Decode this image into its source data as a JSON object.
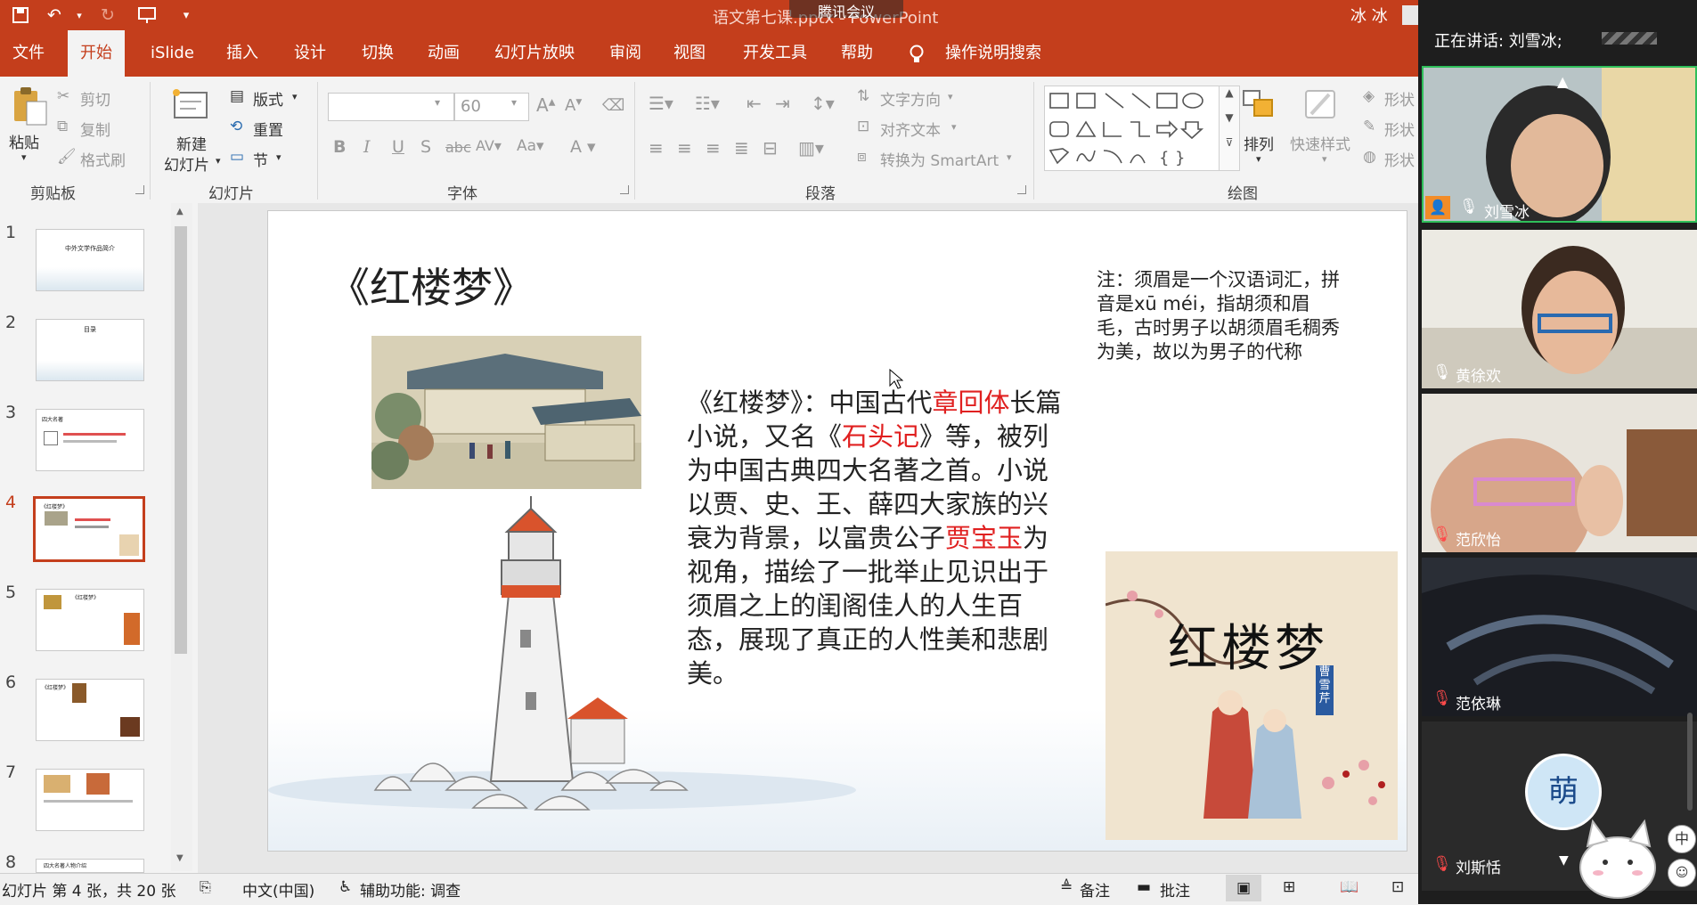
{
  "app": {
    "window_title": "语文第七课.pptx - PowerPoint",
    "meeting_pill": "腾讯会议",
    "user_name": "冰 冰"
  },
  "tabs": [
    "文件",
    "开始",
    "iSlide",
    "插入",
    "设计",
    "切换",
    "动画",
    "幻灯片放映",
    "审阅",
    "视图",
    "开发工具",
    "帮助"
  ],
  "active_tab": "开始",
  "tell_me": "操作说明搜索",
  "ribbon": {
    "clipboard": {
      "paste": "粘贴",
      "cut": "剪切",
      "copy": "复制",
      "format_painter": "格式刷",
      "label": "剪贴板"
    },
    "slides": {
      "new_slide_1": "新建",
      "new_slide_2": "幻灯片",
      "layout": "版式",
      "reset": "重置",
      "section": "节",
      "label": "幻灯片"
    },
    "font": {
      "font_size": "60",
      "label": "字体"
    },
    "paragraph": {
      "text_direction": "文字方向",
      "align_text": "对齐文本",
      "smartart": "转换为 SmartArt",
      "label": "段落"
    },
    "drawing": {
      "arrange": "排列",
      "quick_styles": "快速样式",
      "shape_fill": "形状",
      "shape_outline": "形状",
      "shape_effects": "形状",
      "label": "绘图"
    }
  },
  "thumbnails": [
    {
      "num": "1",
      "title": "中外文学作品简介"
    },
    {
      "num": "2",
      "title": "目录"
    },
    {
      "num": "3",
      "title": "四大名著"
    },
    {
      "num": "4",
      "title": "《红楼梦》"
    },
    {
      "num": "5",
      "title": "《红楼梦》"
    },
    {
      "num": "6",
      "title": "《红楼梦》"
    },
    {
      "num": "7",
      "title": ""
    },
    {
      "num": "8",
      "title": "四大名著人物介绍"
    }
  ],
  "selected_slide": 4,
  "slide": {
    "title": "《红楼梦》",
    "body_parts": [
      {
        "text": "《红楼梦》：中国古代",
        "red": false
      },
      {
        "text": "章回体",
        "red": true
      },
      {
        "text": "长篇小说，又名《",
        "red": false
      },
      {
        "text": "石头记",
        "red": true
      },
      {
        "text": "》等，被列为中国古典四大名著之首。小说以贾、史、王、薛四大家族的兴衰为背景，以富贵公子",
        "red": false
      },
      {
        "text": "贾宝玉",
        "red": true
      },
      {
        "text": "为视角，描绘了一批举止见识出于须眉之上的闺阁佳人的人生百态，展现了真正的人性美和悲剧美。",
        "red": false
      }
    ],
    "note": "注：须眉是一个汉语词汇，拼音是xū méi，指胡须和眉毛，古时男子以胡须眉毛稠秀为美，故以为男子的代称",
    "cover_title": "红楼梦",
    "cover_author": "曹雪芹"
  },
  "status": {
    "slide_info": "幻灯片 第 4 张，共 20 张",
    "language": "中文(中国)",
    "accessibility": "辅助功能: 调查",
    "notes": "备注",
    "comments": "批注"
  },
  "meeting": {
    "speaking": "正在讲话: 刘雪冰;",
    "participants": [
      {
        "name": "刘雪冰",
        "mic": "on",
        "role": "host"
      },
      {
        "name": "黄徐欢",
        "mic": "on"
      },
      {
        "name": "范欣怡",
        "mic": "muted"
      },
      {
        "name": "范依琳",
        "mic": "muted"
      },
      {
        "name": "刘斯恬",
        "mic": "muted",
        "avatar_char": "萌"
      }
    ],
    "ime_char": "中"
  },
  "colors": {
    "accent": "#c43e1c",
    "slide_red": "#e02020",
    "meeting_bg": "#1e1e1e",
    "active_speaker": "#2fbf5a"
  }
}
